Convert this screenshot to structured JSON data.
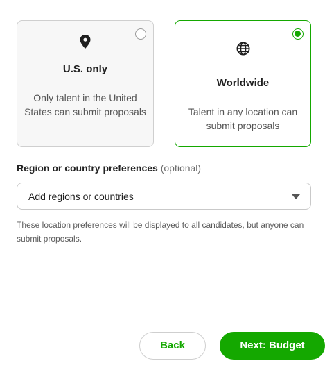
{
  "location_options": [
    {
      "title": "U.S. only",
      "description": "Only talent in the United States can submit proposals",
      "icon": "map-pin-icon",
      "selected": false
    },
    {
      "title": "Worldwide",
      "description": "Talent in any location can submit proposals",
      "icon": "globe-icon",
      "selected": true
    }
  ],
  "preferences": {
    "label": "Region or country preferences",
    "optional_text": "(optional)",
    "placeholder": "Add regions or countries",
    "helper_text": "These location preferences will be displayed to all candidates, but anyone can submit proposals."
  },
  "buttons": {
    "back_label": "Back",
    "next_label": "Next: Budget"
  },
  "colors": {
    "accent": "#14a800",
    "card_unselected_bg": "#f7f7f7",
    "border": "#cfcfcf"
  }
}
